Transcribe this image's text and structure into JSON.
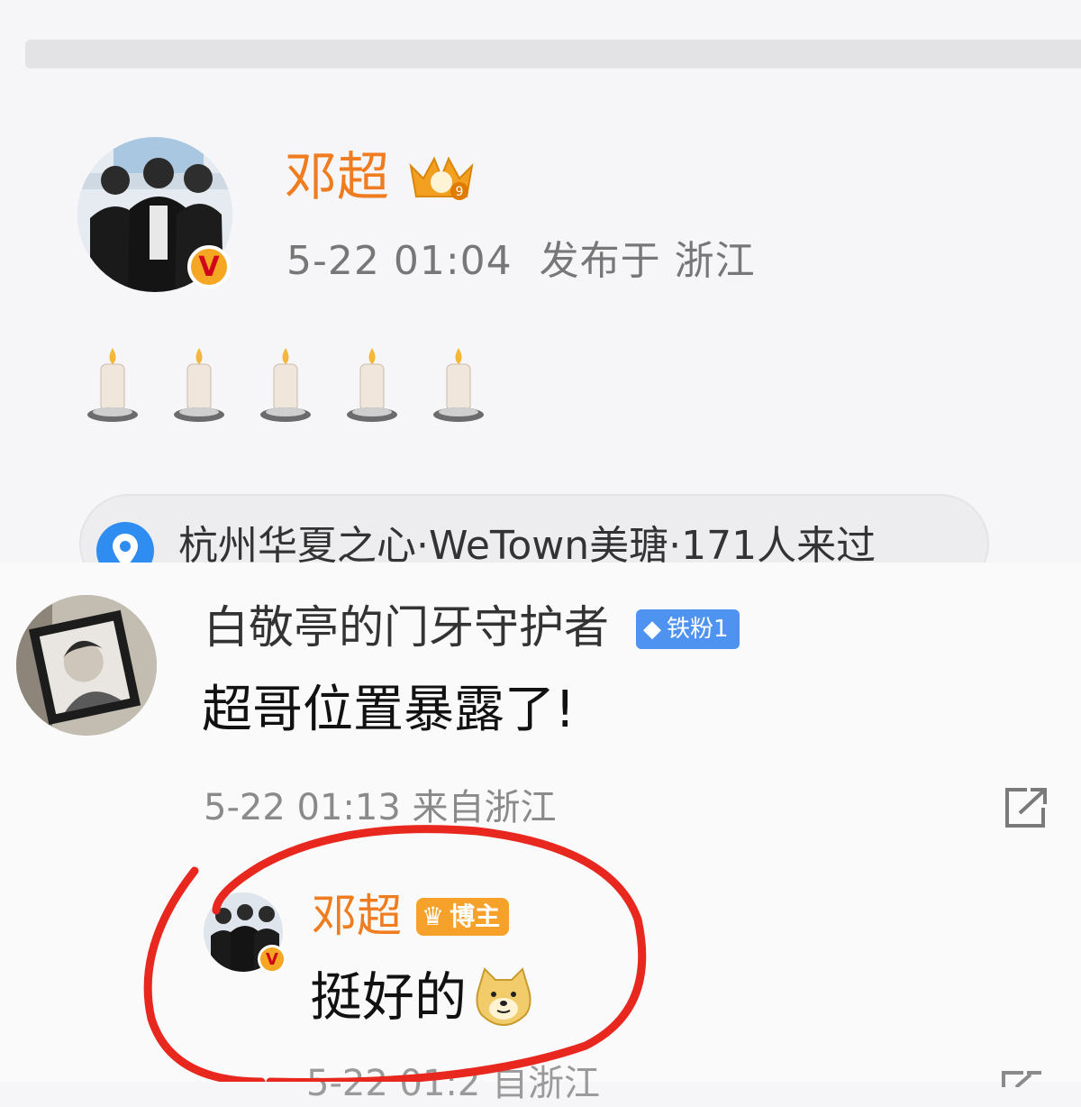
{
  "post": {
    "author": "邓超",
    "meta": "5-22 01:04  发布于 浙江",
    "candle_count": 5,
    "location": "杭州华夏之心·WeTown美瑭·171人来过",
    "crown_level": "9"
  },
  "comment": {
    "author": "白敬亭的门牙守护者",
    "fan_badge": "铁粉1",
    "text": "超哥位置暴露了!",
    "meta": "5-22 01:13 来自浙江"
  },
  "reply": {
    "author": "邓超",
    "host_badge": "博主",
    "text": "挺好的",
    "next_meta_partial": "5-22 01:2  自浙江"
  },
  "icons": {
    "verified": "verified-v-icon",
    "location": "map-pin-icon",
    "share": "share-icon",
    "candle": "candle-emoji-icon",
    "doge": "doge-emoji-icon"
  },
  "colors": {
    "brand_orange": "#ef7c1f",
    "fan_blue": "#4f93f0",
    "annotation_red": "#e8281e"
  }
}
